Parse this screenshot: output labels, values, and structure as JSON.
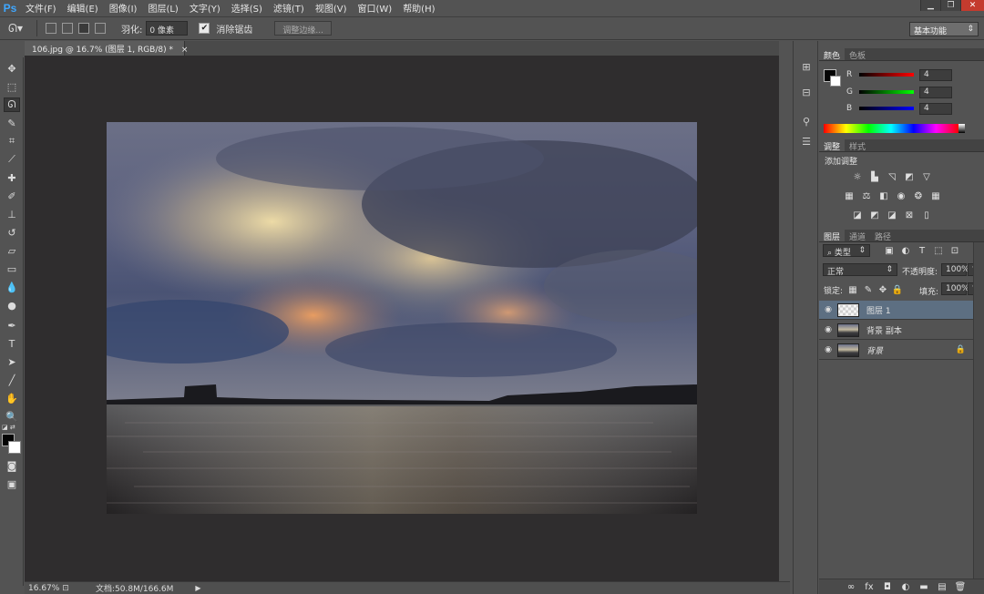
{
  "app": {
    "logo": "Ps"
  },
  "menu": [
    "文件(F)",
    "编辑(E)",
    "图像(I)",
    "图层(L)",
    "文字(Y)",
    "选择(S)",
    "滤镜(T)",
    "视图(V)",
    "窗口(W)",
    "帮助(H)"
  ],
  "window_controls": [
    "minimize-icon",
    "restore-icon",
    "close-icon"
  ],
  "options": {
    "feather_label": "羽化:",
    "feather_value": "0 像素",
    "antialias_label": "消除锯齿",
    "antialias_checked": true,
    "refine_edge_label": "调整边缘...",
    "workspace": "基本功能"
  },
  "document_tab": {
    "title": "106.jpg @ 16.7% (图层 1, RGB/8) *",
    "close": "×"
  },
  "status": {
    "zoom": "16.67%",
    "doc_info": "文档:50.8M/166.6M"
  },
  "color_panel": {
    "tabs": [
      "颜色",
      "色板"
    ],
    "active_tab": 0,
    "channels": [
      {
        "letter": "R",
        "value": "4",
        "gradient_to": "#ff0000"
      },
      {
        "letter": "G",
        "value": "4",
        "gradient_to": "#00ff00"
      },
      {
        "letter": "B",
        "value": "4",
        "gradient_to": "#0000ff"
      }
    ],
    "foreground": "#040404",
    "background": "#ffffff"
  },
  "adjustments_panel": {
    "tabs": [
      "调整",
      "样式"
    ],
    "active_tab": 0,
    "title": "添加调整",
    "icons": [
      [
        "brightness-icon",
        "levels-icon",
        "curves-icon",
        "exposure-icon",
        "vibrance-icon"
      ],
      [
        "hue-saturation-icon",
        "color-balance-icon",
        "black-white-icon",
        "photo-filter-icon",
        "channel-mixer-icon",
        "color-lookup-icon"
      ],
      [
        "invert-icon",
        "posterize-icon",
        "threshold-icon",
        "selective-color-icon",
        "gradient-map-icon"
      ]
    ]
  },
  "layers_panel": {
    "tabs": [
      "图层",
      "通道",
      "路径"
    ],
    "active_tab": 0,
    "filter_kind": "类型",
    "blend_mode": "正常",
    "opacity_label": "不透明度:",
    "opacity_value": "100%",
    "lock_label": "锁定:",
    "fill_label": "填充:",
    "fill_value": "100%",
    "layers": [
      {
        "name": "图层 1",
        "selected": true,
        "type": "transparent",
        "locked": false
      },
      {
        "name": "背景 副本",
        "selected": false,
        "type": "photo",
        "locked": false
      },
      {
        "name": "背景",
        "selected": false,
        "type": "photo",
        "locked": true
      }
    ],
    "footer_icons": [
      "link-icon",
      "fx-icon",
      "mask-icon",
      "adjustment-layer-icon",
      "group-icon",
      "new-layer-icon",
      "trash-icon"
    ]
  }
}
